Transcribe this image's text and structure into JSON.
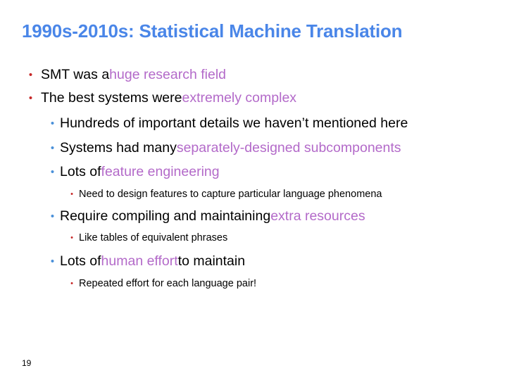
{
  "colors": {
    "title": "#4a86e8",
    "highlight": "#b36ac9",
    "bullet_level1": "#c62828",
    "bullet_level2": "#4a90d9",
    "bullet_level3": "#c62828",
    "text": "#000000"
  },
  "slide": {
    "title": "1990s-2010s: Statistical Machine Translation",
    "number": "19",
    "bullets": [
      {
        "level": 1,
        "marker": "•",
        "segments": [
          {
            "text": "SMT was a ",
            "hl": false
          },
          {
            "text": "huge research field",
            "hl": true
          }
        ]
      },
      {
        "level": 1,
        "marker": "•",
        "segments": [
          {
            "text": "The best systems were ",
            "hl": false
          },
          {
            "text": "extremely complex",
            "hl": true
          }
        ]
      },
      {
        "level": 2,
        "marker": "•",
        "segments": [
          {
            "text": "Hundreds of important details we haven’t mentioned here",
            "hl": false
          }
        ]
      },
      {
        "level": 2,
        "marker": "•",
        "segments": [
          {
            "text": "Systems had many ",
            "hl": false
          },
          {
            "text": "separately-designed subcomponents",
            "hl": true
          }
        ]
      },
      {
        "level": 2,
        "marker": "•",
        "segments": [
          {
            "text": "Lots of ",
            "hl": false
          },
          {
            "text": "feature engineering",
            "hl": true
          }
        ]
      },
      {
        "level": 3,
        "marker": "•",
        "segments": [
          {
            "text": "Need to design features to capture particular language phenomena",
            "hl": false
          }
        ]
      },
      {
        "level": 2,
        "marker": "•",
        "segments": [
          {
            "text": "Require compiling and maintaining ",
            "hl": false
          },
          {
            "text": "extra resources",
            "hl": true
          }
        ]
      },
      {
        "level": 3,
        "marker": "•",
        "segments": [
          {
            "text": "Like tables of equivalent phrases",
            "hl": false
          }
        ]
      },
      {
        "level": 2,
        "marker": "•",
        "segments": [
          {
            "text": "Lots of ",
            "hl": false
          },
          {
            "text": "human effort",
            "hl": true
          },
          {
            "text": " to maintain",
            "hl": false
          }
        ]
      },
      {
        "level": 3,
        "marker": "•",
        "segments": [
          {
            "text": "Repeated effort for each language pair!",
            "hl": false
          }
        ]
      }
    ]
  }
}
